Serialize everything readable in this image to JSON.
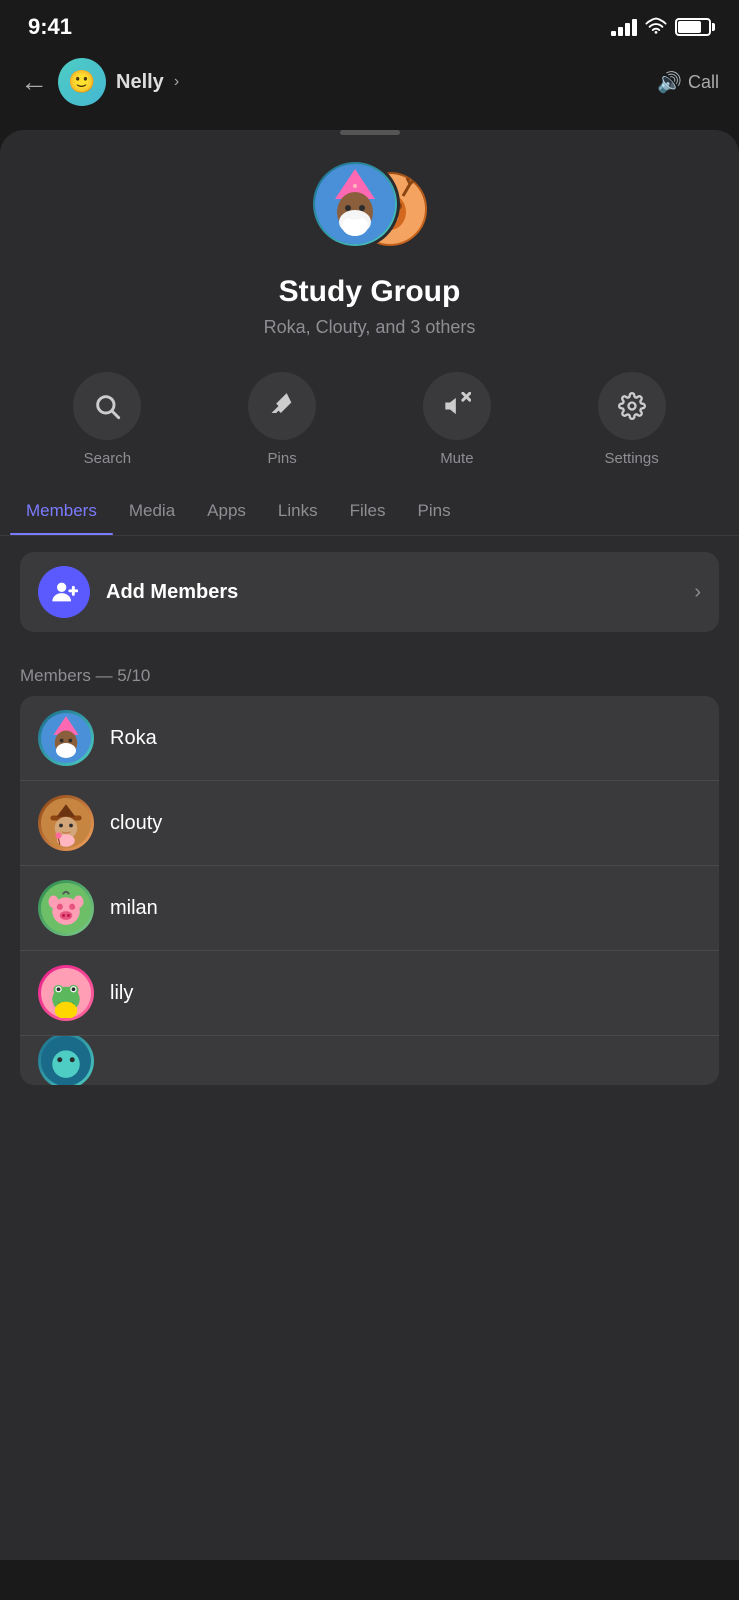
{
  "status_bar": {
    "time": "9:41",
    "signal": "signal",
    "wifi": "wifi",
    "battery": "battery"
  },
  "top_nav": {
    "back_label": "←",
    "contact_name": "Nelly",
    "contact_name_chevron": "›",
    "call_label": "Call",
    "call_icon": "🔊"
  },
  "sheet": {
    "handle": "handle",
    "group_name": "Study Group",
    "group_members_text": "Roka, Clouty, and 3 others",
    "avatar_front_emoji": "🧙",
    "avatar_back_emoji": "🦌"
  },
  "action_buttons": [
    {
      "id": "search",
      "icon": "🔍",
      "label": "Search"
    },
    {
      "id": "pins",
      "icon": "📌",
      "label": "Pins"
    },
    {
      "id": "mute",
      "icon": "🔇",
      "label": "Mute"
    },
    {
      "id": "settings",
      "icon": "⚙️",
      "label": "Settings"
    }
  ],
  "tabs": [
    {
      "id": "members",
      "label": "Members",
      "active": true
    },
    {
      "id": "media",
      "label": "Media",
      "active": false
    },
    {
      "id": "apps",
      "label": "Apps",
      "active": false
    },
    {
      "id": "links",
      "label": "Links",
      "active": false
    },
    {
      "id": "files",
      "label": "Files",
      "active": false
    },
    {
      "id": "pins",
      "label": "Pins",
      "active": false
    }
  ],
  "add_members": {
    "label": "Add Members",
    "icon": "👤+",
    "chevron": "›"
  },
  "members_section": {
    "count_label": "Members — 5/10"
  },
  "members": [
    {
      "id": "roka",
      "name": "Roka",
      "avatar_class": "av-roka",
      "emoji": "🧙"
    },
    {
      "id": "clouty",
      "name": "clouty",
      "avatar_class": "av-clouty",
      "emoji": "🤠"
    },
    {
      "id": "milan",
      "name": "milan",
      "avatar_class": "av-milan",
      "emoji": "🐷"
    },
    {
      "id": "lily",
      "name": "lily",
      "avatar_class": "av-lily",
      "emoji": "🐸"
    },
    {
      "id": "last",
      "name": "",
      "avatar_class": "av-last",
      "emoji": "🦎"
    }
  ]
}
